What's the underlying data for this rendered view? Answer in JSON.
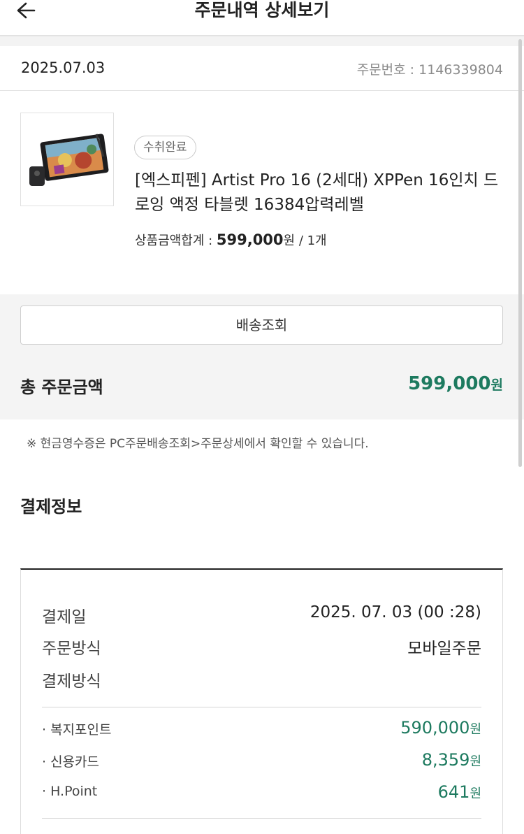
{
  "header": {
    "title": "주문내역 상세보기"
  },
  "order": {
    "date": "2025.07.03",
    "number_label": "주문번호 : 1146339804"
  },
  "product": {
    "status": "수취완료",
    "name": "[엑스피펜] Artist Pro 16 (2세대) XPPen 16인치 드로잉 액정 타블렛 16384압력레벨",
    "price_label": "상품금액합계 : ",
    "price": "599,000",
    "price_unit_qty": "원 / 1개"
  },
  "delivery_button": "배송조회",
  "total": {
    "label": "총 주문금액",
    "amount": "599,000",
    "unit": "원"
  },
  "notice": "※ 현금영수증은 PC주문배송조회>주문상세에서 확인할 수 있습니다.",
  "payment": {
    "title": "결제정보",
    "rows": [
      {
        "label": "결제일",
        "value": "2025. 07. 03 (00 :28)"
      },
      {
        "label": "주문방식",
        "value": "모바일주문"
      },
      {
        "label": "결제방식",
        "value": ""
      }
    ],
    "methods": [
      {
        "label": "· 복지포인트",
        "amount": "590,000",
        "unit": "원"
      },
      {
        "label": "· 신용카드",
        "amount": "8,359",
        "unit": "원"
      },
      {
        "label": "· H.Point",
        "amount": "641",
        "unit": "원"
      }
    ]
  },
  "colors": {
    "accent": "#1d7a5f",
    "gray_bg": "#f4f4f4"
  }
}
